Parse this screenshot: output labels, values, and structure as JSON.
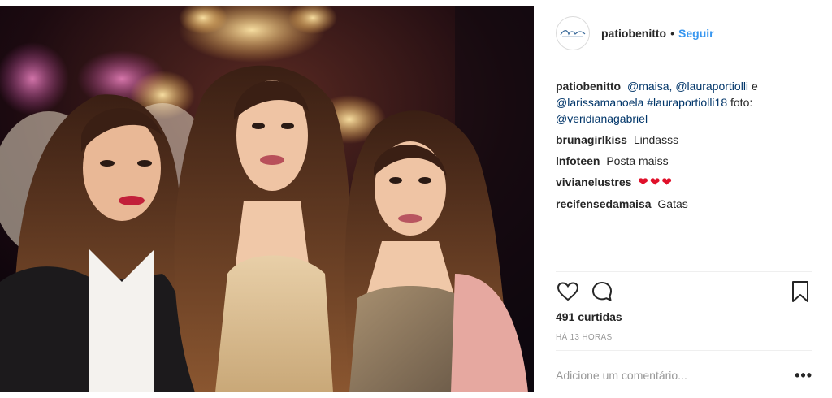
{
  "post": {
    "image_alt": "",
    "author": "patiobenitto",
    "dot": "•",
    "follow_label": "Seguir"
  },
  "caption": {
    "user": "patiobenitto",
    "mention1": "@maisa,",
    "mention2": "@lauraportiolli",
    "conj": "e",
    "mention3": "@larissamanoela",
    "hashtag": "#lauraportiolli18",
    "foto_label": "foto:",
    "mention4": "@veridianagabriel"
  },
  "comments": [
    {
      "user": "brunagirlkiss",
      "text": "Lindasss"
    },
    {
      "user": "lnfoteen",
      "text": "Posta maiss"
    },
    {
      "user": "vivianelustres",
      "text": "❤❤❤"
    },
    {
      "user": "recifensedamaisa",
      "text": "Gatas"
    }
  ],
  "stats": {
    "likes": "491 curtidas",
    "time": "HÁ 13 HORAS"
  },
  "add_comment": {
    "placeholder": "Adicione um comentário...",
    "more": "•••"
  },
  "icons": {
    "like": "heart-icon",
    "comment": "comment-bubble-icon",
    "save": "bookmark-icon",
    "avatar": "brand-logo"
  },
  "colors": {
    "follow": "#3897f0",
    "mention": "#003569",
    "heart": "#e0102a"
  }
}
